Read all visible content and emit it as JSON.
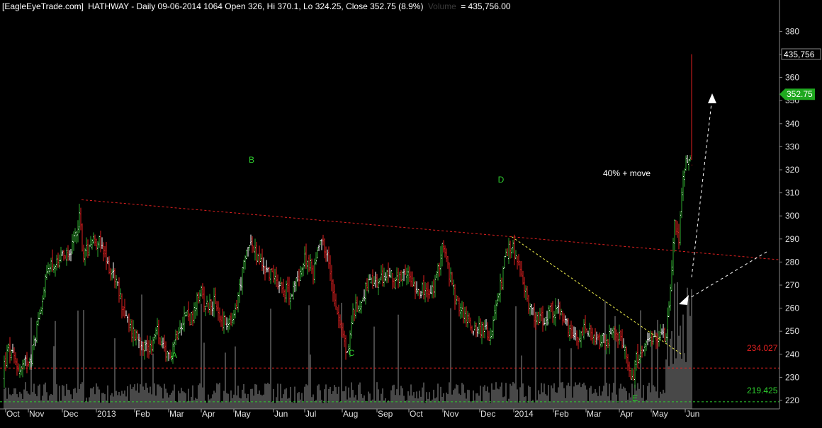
{
  "header": {
    "site": "[EagleEyeTrade.com]",
    "info": "HATHWAY - Daily 09-06-2014 1064 Open 326, Hi 370.1, Lo 324.25, Close 352.75 (8.9%)",
    "volume_label": "Volume",
    "volume_value": "= 435,756.00"
  },
  "colors": {
    "up": "#2ea82e",
    "down": "#e02020",
    "flat": "#ffffff",
    "volume": "#5a5a5a",
    "resistance": "#e02020",
    "support_red": "#e02020",
    "support_green": "#2ecc2e",
    "arrow": "#ffffff",
    "trend": "#e8e84a",
    "accent_green": "#1fa81f"
  },
  "chart_data": {
    "type": "candlestick",
    "title": "HATHWAY - Daily",
    "ylim": [
      215,
      385
    ],
    "y_ticks": [
      220,
      230,
      240,
      250,
      260,
      270,
      280,
      290,
      300,
      310,
      320,
      330,
      340,
      350,
      360,
      370,
      380
    ],
    "x_ticks": [
      "Oct",
      "Nov",
      "Dec",
      "2013",
      "Feb",
      "Mar",
      "Apr",
      "May",
      "Jun",
      "Jul",
      "Aug",
      "Sep",
      "Oct",
      "Nov",
      "Dec",
      "2014",
      "Feb",
      "Mar",
      "Apr",
      "May",
      "Jun"
    ],
    "last_bar": {
      "date": "09-06-2014",
      "open": 326,
      "high": 370.1,
      "low": 324.25,
      "close": 352.75,
      "change_pct": 8.9,
      "volume": 435756
    },
    "pivots": [
      {
        "label": "A",
        "price": 228
      },
      {
        "label": "B",
        "price": 302
      },
      {
        "label": "C",
        "price": 235
      },
      {
        "label": "D",
        "price": 292
      },
      {
        "label": "E",
        "price": 219
      }
    ],
    "horizontal_levels": [
      {
        "value": 234.027,
        "label": "234.027",
        "color": "red"
      },
      {
        "value": 219.425,
        "label": "219.425",
        "color": "green"
      }
    ],
    "price_tags": [
      {
        "label": "435,756",
        "kind": "volume"
      },
      {
        "label": "352.75",
        "kind": "close"
      }
    ],
    "annotation": "40% + move",
    "resistance_line": {
      "from_price": 307,
      "to_price": 281
    },
    "trend_line": {
      "from_price": 291,
      "to_price": 240
    }
  }
}
